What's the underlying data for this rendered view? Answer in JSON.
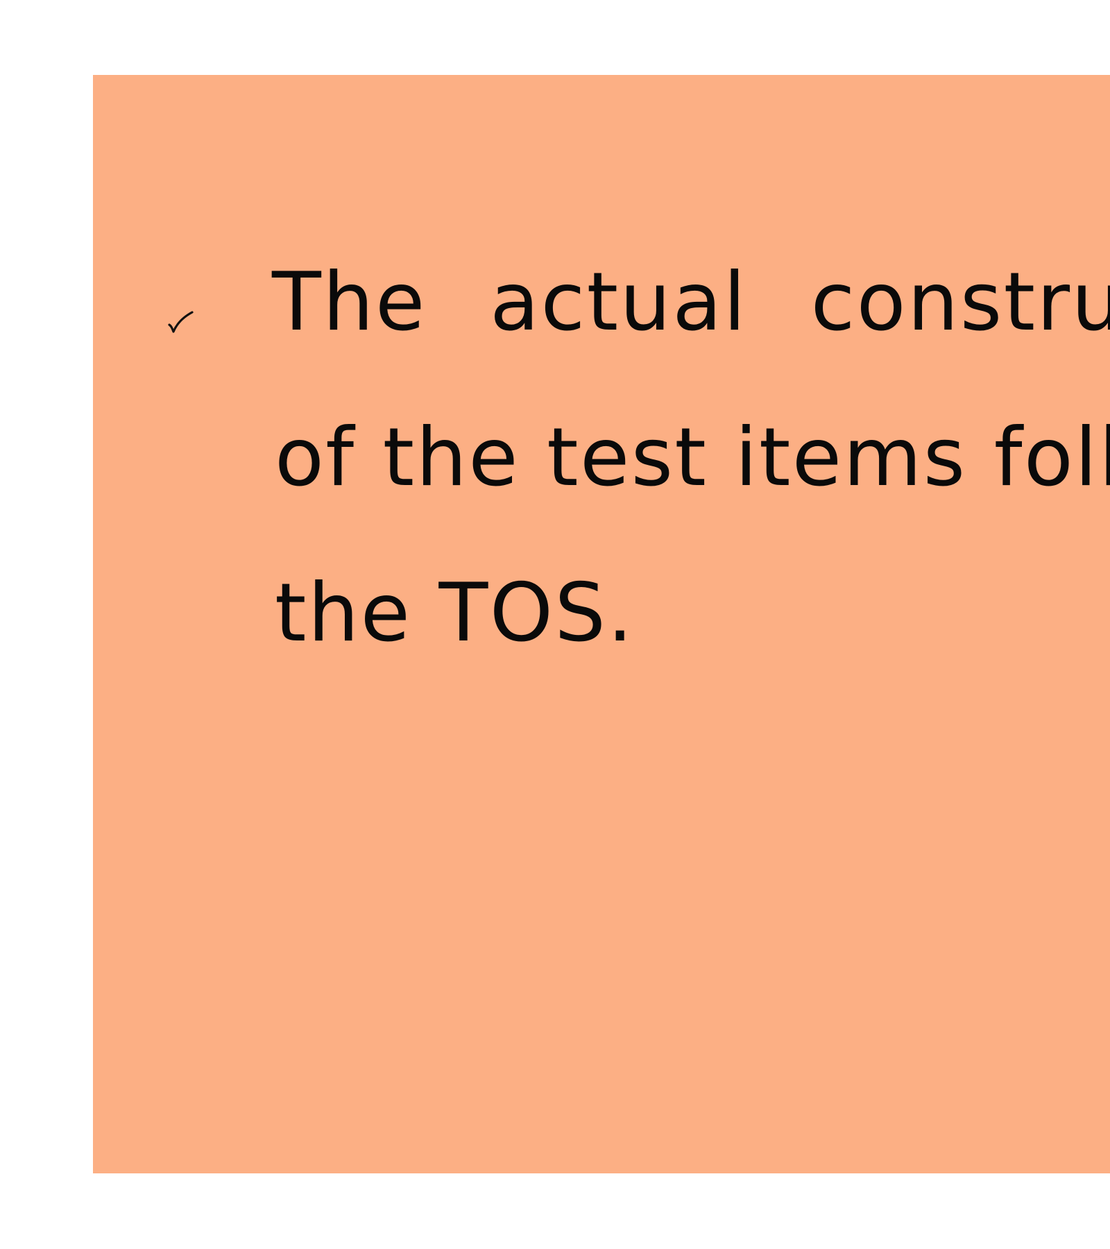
{
  "slide": {
    "background_color": "#fcaf84",
    "bullet": {
      "icon": "checkmark-icon",
      "lines": [
        "The actual construction",
        "of the test items follows",
        "the TOS."
      ]
    }
  }
}
